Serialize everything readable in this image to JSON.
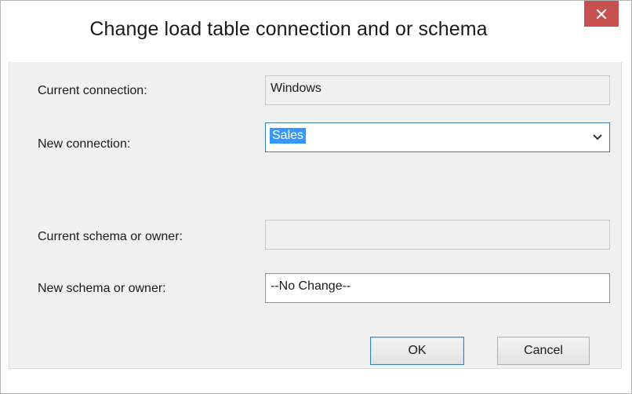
{
  "dialog": {
    "title": "Change load table connection and or schema",
    "close_glyph": "✕"
  },
  "form": {
    "current_connection_label": "Current connection:",
    "current_connection_value": "Windows",
    "new_connection_label": "New connection:",
    "new_connection_value": "Sales",
    "current_schema_label": "Current schema or owner:",
    "current_schema_value": "",
    "new_schema_label": "New schema or owner:",
    "new_schema_value": "--No Change--"
  },
  "buttons": {
    "ok_label": "OK",
    "cancel_label": "Cancel"
  },
  "icons": {
    "close": "close-icon",
    "dropdown": "chevron-down-icon"
  },
  "colors": {
    "close_button": "#c75050",
    "selection": "#3399ff",
    "focus_border": "#3c7fb1"
  }
}
